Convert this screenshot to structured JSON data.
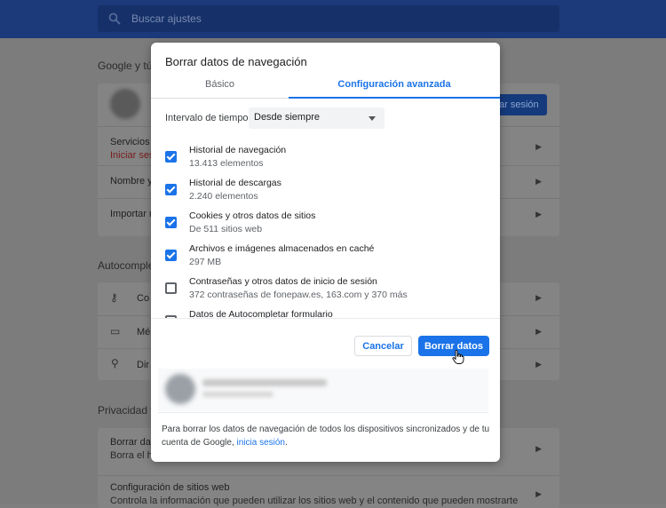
{
  "background": {
    "search_placeholder": "Buscar ajustes",
    "sections": {
      "google": "Google y tú",
      "autofill": "Autocomplet",
      "privacy": "Privacidad y"
    },
    "signin_button": "ar sesión",
    "rows": {
      "services": "Servicios d",
      "services_sub": "Iniciar ses",
      "name": "Nombre y",
      "import": "Importar m",
      "passwords": "Co",
      "payments": "Mé",
      "addresses": "Dir",
      "clear": "Borrar dat",
      "clear_sub": "Borra el hi",
      "site_settings": "Configuración de sitios web",
      "site_settings_sub": "Controla la información que pueden utilizar los sitios web y el contenido que pueden mostrarte"
    }
  },
  "dialog": {
    "title": "Borrar datos de navegación",
    "tabs": {
      "basic": "Básico",
      "advanced": "Configuración avanzada",
      "active": "advanced"
    },
    "time_range": {
      "label": "Intervalo de tiempo",
      "value": "Desde siempre"
    },
    "items": [
      {
        "title": "Historial de navegación",
        "subtitle": "13.413 elementos",
        "checked": true
      },
      {
        "title": "Historial de descargas",
        "subtitle": "2.240 elementos",
        "checked": true
      },
      {
        "title": "Cookies y otros datos de sitios",
        "subtitle": "De 511 sitios web",
        "checked": true
      },
      {
        "title": "Archivos e imágenes almacenados en caché",
        "subtitle": "297 MB",
        "checked": true
      },
      {
        "title": "Contraseñas y otros datos de inicio de sesión",
        "subtitle": "372 contraseñas de fonepaw.es, 163.com y 370 más",
        "checked": false
      },
      {
        "title": "Datos de Autocompletar formulario",
        "subtitle": "",
        "checked": false
      }
    ],
    "buttons": {
      "cancel": "Cancelar",
      "clear": "Borrar datos"
    },
    "footer": {
      "text": "Para borrar los datos de navegación de todos los dispositivos sincronizados y de tu cuenta de Google, ",
      "link": "inicia sesión",
      "end": "."
    }
  },
  "colors": {
    "accent": "#1a73e8",
    "topbar": "#1c3a7a"
  }
}
